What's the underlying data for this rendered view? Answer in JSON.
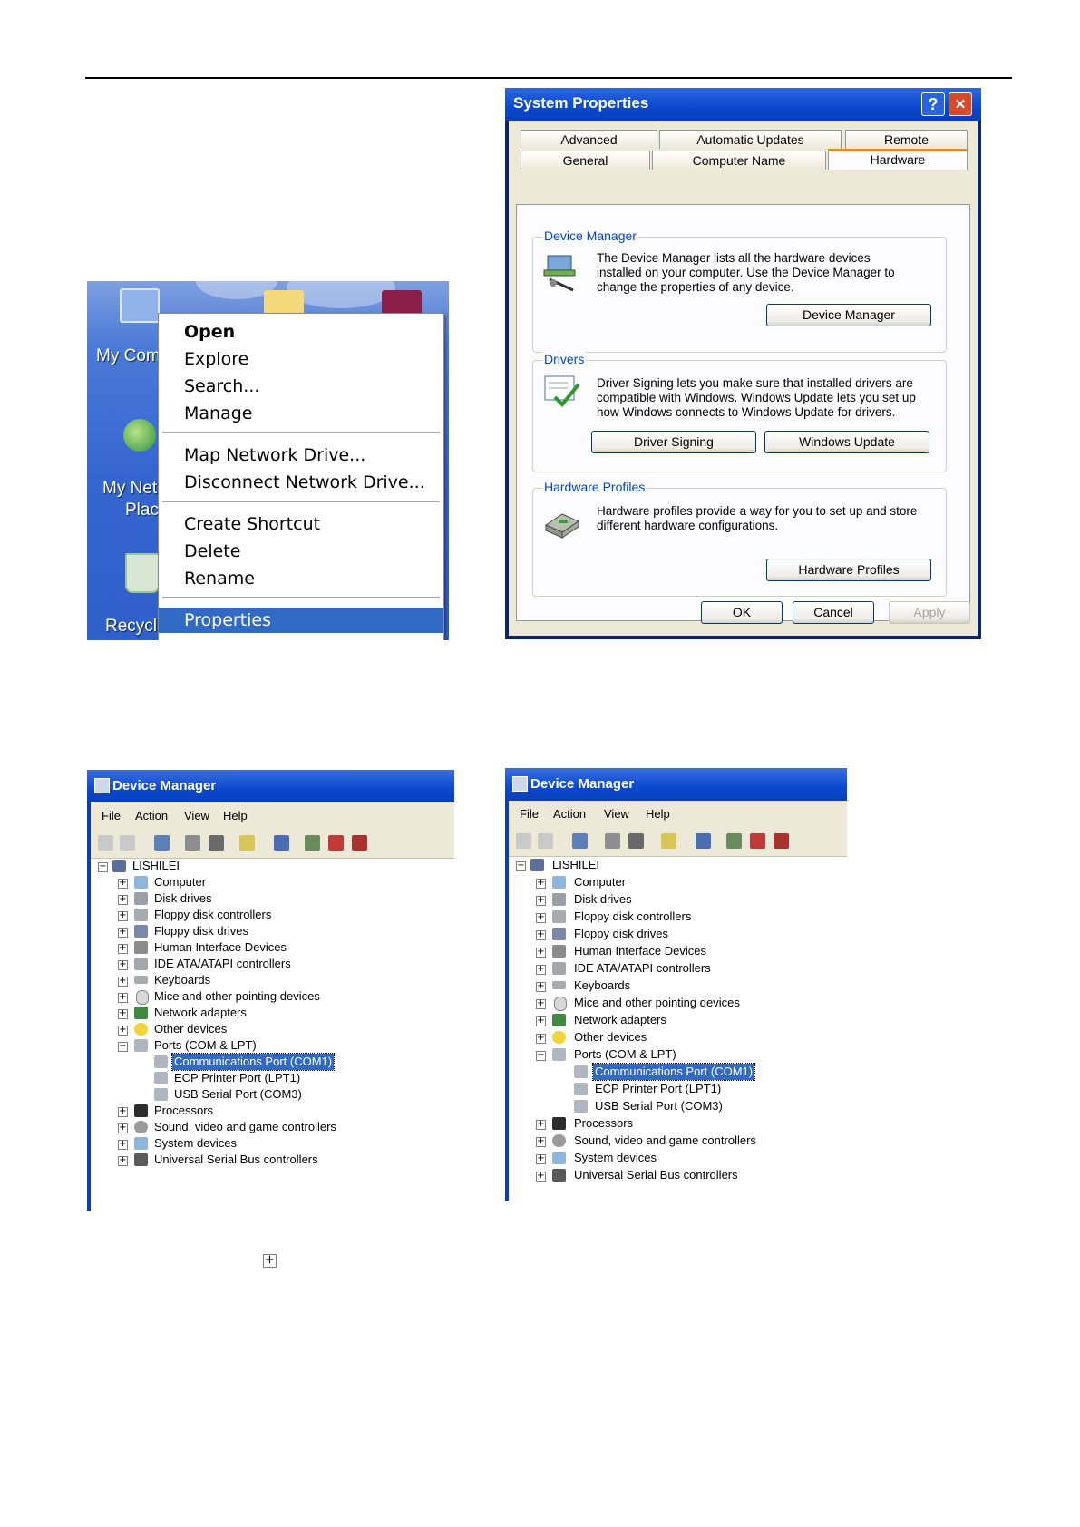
{
  "desktop": {
    "icons": [
      "My Com",
      "My Net",
      "Plac",
      "Recycl"
    ],
    "menu": {
      "items": [
        {
          "label": "Open",
          "bold": true
        },
        {
          "label": "Explore"
        },
        {
          "label": "Search..."
        },
        {
          "label": "Manage"
        },
        {
          "label": "Map Network Drive..."
        },
        {
          "label": "Disconnect Network Drive..."
        },
        {
          "label": "Create Shortcut"
        },
        {
          "label": "Delete"
        },
        {
          "label": "Rename"
        },
        {
          "label": "Properties",
          "selected": true
        }
      ]
    }
  },
  "system_properties": {
    "title": "System Properties",
    "help_glyph": "?",
    "close_glyph": "✕",
    "tabs_row1": [
      "Advanced",
      "Automatic Updates",
      "Remote"
    ],
    "tabs_row2": [
      "General",
      "Computer Name",
      "Hardware"
    ],
    "active_tab": "Hardware",
    "device_manager": {
      "label": "Device Manager",
      "text": "The Device Manager lists all the hardware devices installed on your computer. Use the Device Manager to change the properties of any device.",
      "button": "Device Manager"
    },
    "drivers": {
      "label": "Drivers",
      "text": "Driver Signing lets you make sure that installed drivers are compatible with Windows. Windows Update lets you set up how Windows connects to Windows Update for drivers.",
      "button1": "Driver Signing",
      "button2": "Windows Update"
    },
    "hardware_profiles": {
      "label": "Hardware Profiles",
      "text": "Hardware profiles provide a way for you to set up and store different hardware configurations.",
      "button": "Hardware Profiles"
    },
    "ok": "OK",
    "cancel": "Cancel",
    "apply": "Apply"
  },
  "device_manager": {
    "title": "Device Manager",
    "menu": [
      "File",
      "Action",
      "View",
      "Help"
    ],
    "root": "LISHILEI",
    "categories_before": [
      "Computer",
      "Disk drives",
      "Floppy disk controllers",
      "Floppy disk drives",
      "Human Interface Devices",
      "IDE ATA/ATAPI controllers",
      "Keyboards",
      "Mice and other pointing devices",
      "Network adapters",
      "Other devices"
    ],
    "ports_label": "Ports (COM & LPT)",
    "ports": [
      "Communications Port (COM1)",
      "ECP Printer Port (LPT1)",
      "USB Serial Port (COM3)"
    ],
    "selected_port": "Communications Port (COM1)",
    "categories_after": [
      "Processors",
      "Sound, video and game controllers",
      "System devices",
      "Universal Serial Bus controllers"
    ]
  },
  "standalone_plus": "+",
  "colors": {
    "xp_title_blue": "#0b48cf",
    "selection_blue": "#316ac5",
    "group_label_blue": "#0046d5",
    "dialog_bg": "#ece9d8",
    "active_tab_accent": "#e68b2c"
  }
}
